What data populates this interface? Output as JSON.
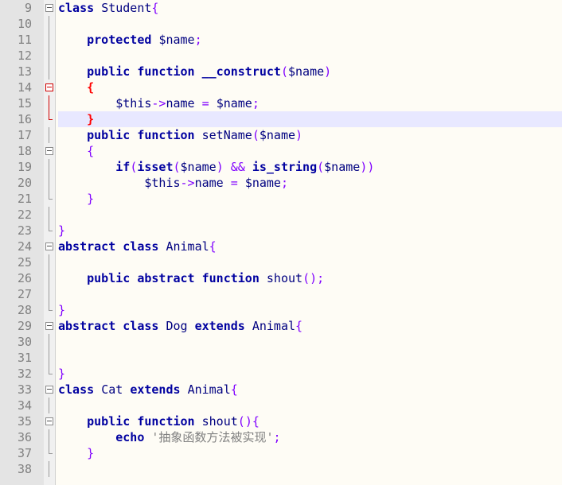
{
  "lines": [
    {
      "n": "9",
      "text": "class Student{"
    },
    {
      "n": "10",
      "text": ""
    },
    {
      "n": "11",
      "text": "    protected $name;"
    },
    {
      "n": "12",
      "text": ""
    },
    {
      "n": "13",
      "text": "    public function __construct($name)"
    },
    {
      "n": "14",
      "text": "    {"
    },
    {
      "n": "15",
      "text": "        $this->name = $name;"
    },
    {
      "n": "16",
      "text": "    }"
    },
    {
      "n": "17",
      "text": "    public function setName($name)"
    },
    {
      "n": "18",
      "text": "    {"
    },
    {
      "n": "19",
      "text": "        if(isset($name) && is_string($name))"
    },
    {
      "n": "20",
      "text": "            $this->name = $name;"
    },
    {
      "n": "21",
      "text": "    }"
    },
    {
      "n": "22",
      "text": ""
    },
    {
      "n": "23",
      "text": "}"
    },
    {
      "n": "24",
      "text": "abstract class Animal{"
    },
    {
      "n": "25",
      "text": ""
    },
    {
      "n": "26",
      "text": "    public abstract function shout();"
    },
    {
      "n": "27",
      "text": ""
    },
    {
      "n": "28",
      "text": "}"
    },
    {
      "n": "29",
      "text": "abstract class Dog extends Animal{"
    },
    {
      "n": "30",
      "text": ""
    },
    {
      "n": "31",
      "text": ""
    },
    {
      "n": "32",
      "text": "}"
    },
    {
      "n": "33",
      "text": "class Cat extends Animal{"
    },
    {
      "n": "34",
      "text": ""
    },
    {
      "n": "35",
      "text": "    public function shout(){"
    },
    {
      "n": "36",
      "text": "        echo '抽象函数方法被实现';"
    },
    {
      "n": "37",
      "text": "    }"
    },
    {
      "n": "38",
      "text": ""
    }
  ],
  "current_line": "16",
  "colors": {
    "keyword": "#0000a0",
    "variable": "#000080",
    "operator": "#8000ff",
    "string": "#808080",
    "brace_match": "#ff0000",
    "current_line_bg": "#e8e8ff",
    "gutter_bg": "#e4e4e4"
  }
}
